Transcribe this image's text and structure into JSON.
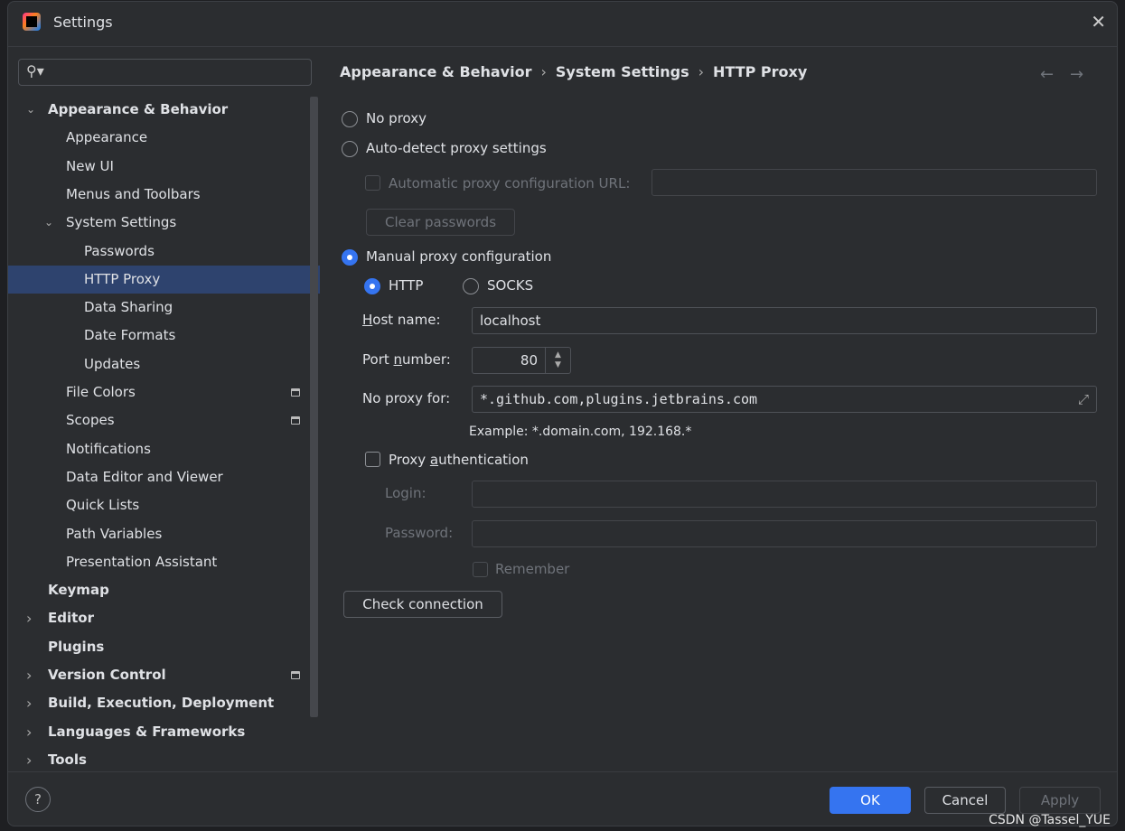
{
  "window": {
    "title": "Settings",
    "close_icon": "close-icon",
    "logo": "intellij-idea-logo"
  },
  "search": {
    "placeholder": "",
    "icon": "search-icon"
  },
  "tree": [
    {
      "label": "Appearance & Behavior",
      "level": 0,
      "expanded": true,
      "bold": true
    },
    {
      "label": "Appearance",
      "level": 1
    },
    {
      "label": "New UI",
      "level": 1
    },
    {
      "label": "Menus and Toolbars",
      "level": 1
    },
    {
      "label": "System Settings",
      "level": 1,
      "expanded": true
    },
    {
      "label": "Passwords",
      "level": 2
    },
    {
      "label": "HTTP Proxy",
      "level": 2,
      "selected": true
    },
    {
      "label": "Data Sharing",
      "level": 2
    },
    {
      "label": "Date Formats",
      "level": 2
    },
    {
      "label": "Updates",
      "level": 2
    },
    {
      "label": "File Colors",
      "level": 1,
      "badge": true
    },
    {
      "label": "Scopes",
      "level": 1,
      "badge": true
    },
    {
      "label": "Notifications",
      "level": 1
    },
    {
      "label": "Data Editor and Viewer",
      "level": 1
    },
    {
      "label": "Quick Lists",
      "level": 1
    },
    {
      "label": "Path Variables",
      "level": 1
    },
    {
      "label": "Presentation Assistant",
      "level": 1
    },
    {
      "label": "Keymap",
      "level": 0,
      "bold": true
    },
    {
      "label": "Editor",
      "level": 0,
      "collapsed": true,
      "bold": true
    },
    {
      "label": "Plugins",
      "level": 0,
      "bold": true
    },
    {
      "label": "Version Control",
      "level": 0,
      "collapsed": true,
      "bold": true,
      "badge": true
    },
    {
      "label": "Build, Execution, Deployment",
      "level": 0,
      "collapsed": true,
      "bold": true
    },
    {
      "label": "Languages & Frameworks",
      "level": 0,
      "collapsed": true,
      "bold": true
    },
    {
      "label": "Tools",
      "level": 0,
      "collapsed": true,
      "bold": true
    }
  ],
  "breadcrumb": [
    "Appearance & Behavior",
    "System Settings",
    "HTTP Proxy"
  ],
  "nav": {
    "back": "←",
    "forward": "→"
  },
  "proxy": {
    "no_proxy": "No proxy",
    "auto_detect": "Auto-detect proxy settings",
    "auto_url_label": "Automatic proxy configuration URL:",
    "auto_url_value": "",
    "clear_passwords": "Clear passwords",
    "manual": "Manual proxy configuration",
    "selected_mode": "Manual proxy configuration",
    "http": "HTTP",
    "socks": "SOCKS",
    "selected_type": "HTTP",
    "host_label_u": "H",
    "host_label_rest": "ost name:",
    "host_value": "localhost",
    "port_label_a": "Port ",
    "port_label_u": "n",
    "port_label_b": "umber:",
    "port_value": "80",
    "no_proxy_for_label": "No proxy for:",
    "no_proxy_for_value": "*.github.com,plugins.jetbrains.com",
    "example": "Example: *.domain.com, 192.168.*",
    "auth_a": "Proxy ",
    "auth_u": "a",
    "auth_b": "uthentication",
    "auth_checked": false,
    "login_label": "Login:",
    "login_value": "",
    "password_label": "Password:",
    "password_value": "",
    "remember": "Remember",
    "check_connection": "Check connection"
  },
  "footer": {
    "help": "?",
    "ok": "OK",
    "cancel": "Cancel",
    "apply": "Apply"
  },
  "watermark": "CSDN @Tassel_YUE"
}
